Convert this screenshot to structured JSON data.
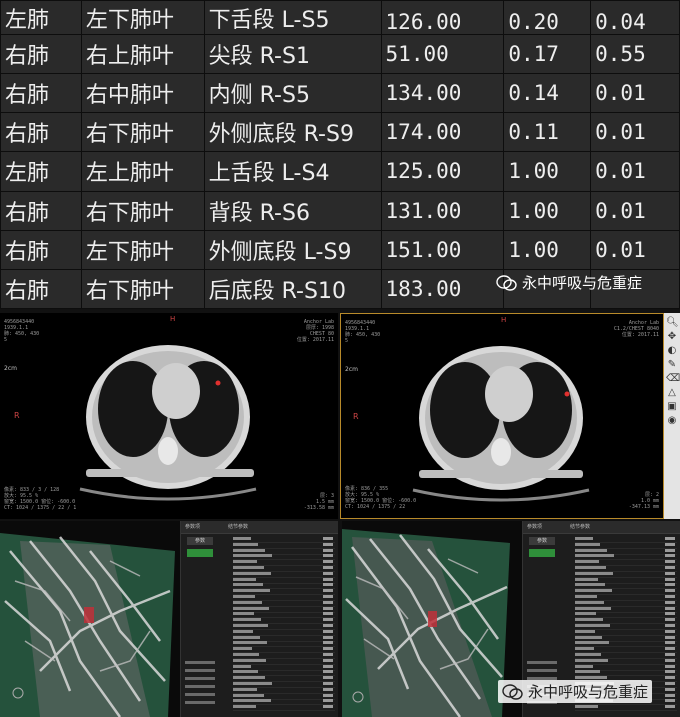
{
  "nodule_table": {
    "rows": [
      [
        "左肺",
        "左下肺叶",
        "下舌段 L-S5",
        "126.00",
        "0.20",
        "0.04"
      ],
      [
        "右肺",
        "右上肺叶",
        "尖段 R-S1",
        "51.00",
        "0.17",
        "0.55"
      ],
      [
        "右肺",
        "右中肺叶",
        "内侧 R-S5",
        "134.00",
        "0.14",
        "0.01"
      ],
      [
        "右肺",
        "右下肺叶",
        "外侧底段 R-S9",
        "174.00",
        "0.11",
        "0.01"
      ],
      [
        "左肺",
        "左上肺叶",
        "上舌段 L-S4",
        "125.00",
        "1.00",
        "0.01"
      ],
      [
        "右肺",
        "右下肺叶",
        "背段 R-S6",
        "131.00",
        "1.00",
        "0.01"
      ],
      [
        "右肺",
        "左下肺叶",
        "外侧底段 L-S9",
        "151.00",
        "1.00",
        "0.01"
      ],
      [
        "右肺",
        "右下肺叶",
        "后底段 R-S10",
        "183.00",
        "",
        ""
      ]
    ]
  },
  "ct_viewers": {
    "left": {
      "top_left": "4956843440\n1939.1.1\n肺: 450, 430\n5",
      "top_right": "Anchor Lab\n层厚: 1998\nCHEST 80\n位置: 2017.11",
      "bottom_left": "像素: 833 / 3 / 128\n放大: 95.5 %\n窗宽: 1500.0 窗位: -600.0\nCT: 1024 / 1375 / 22 / 1",
      "bottom_right": "层: 3\n1.5 mm\n-313.58 mm",
      "scale_label": "2cm",
      "side_marker": "R",
      "top_marker": "H"
    },
    "right": {
      "top_left": "4956843440\n1939.1.1\n肺: 450, 430\n5",
      "top_right": "Anchor Lab\nC1.2/CHEST 8040\n位置: 2017.11",
      "bottom_left": "像素: 836 / 355\n放大: 95.5 %\n窗宽: 1500.0 窗位: -600.0\nCT: 1024 / 1375 / 22",
      "bottom_right": "层: 2\n1.0 mm\n-347.13 mm",
      "scale_label": "2cm",
      "side_marker": "R",
      "top_marker": "H"
    }
  },
  "toolbar": {
    "icons": [
      "zoom-icon",
      "pan-icon",
      "window-level-icon",
      "measure-icon",
      "eraser-icon",
      "roi-icon",
      "save-icon",
      "camera-icon"
    ]
  },
  "vr_panels": {
    "left": {
      "header": [
        "参数项",
        "结节参数"
      ],
      "tab_label": "参数"
    },
    "right": {
      "header": [
        "参数项",
        "结节参数"
      ],
      "tab_label": "参数"
    }
  },
  "watermark": {
    "text": "永中呼吸与危重症"
  },
  "colors": {
    "table_bg": "#2a2a2a",
    "viewer_border": "#b88a2a",
    "lesion": "#e0302e",
    "vr_vessel": "#d9d9d9",
    "vr_lung": "#2f6b4d"
  }
}
